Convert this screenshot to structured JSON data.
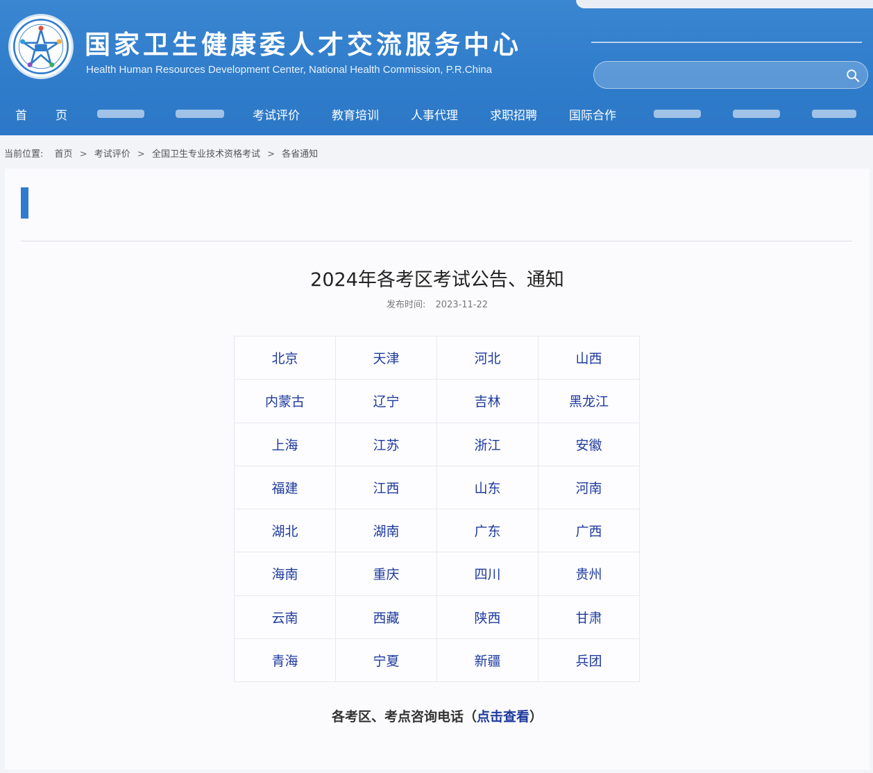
{
  "header": {
    "site_title": "国家卫生健康委人才交流服务中心",
    "site_subtitle": "Health Human Resources Development Center, National Health Commission, P.R.China",
    "search_placeholder": "",
    "colors": {
      "header_blue": "#2f7ccb",
      "link_blue": "#1e3a9e",
      "accent_bar": "#2f7bd0"
    }
  },
  "nav": {
    "items": [
      {
        "label": "首"
      },
      {
        "label": "页"
      },
      {
        "label": "考试评价"
      },
      {
        "label": "教育培训"
      },
      {
        "label": "人事代理"
      },
      {
        "label": "求职招聘"
      },
      {
        "label": "国际合作"
      }
    ]
  },
  "breadcrumb": {
    "prefix": "当前位置:",
    "items": [
      "首页",
      "考试评价",
      "全国卫生专业技术资格考试",
      "各省通知"
    ],
    "separator": ">"
  },
  "article": {
    "title": "2024年各考区考试公告、通知",
    "publish_label": "发布时间:",
    "publish_date": "2023-11-22",
    "regions": [
      [
        "北京",
        "天津",
        "河北",
        "山西"
      ],
      [
        "内蒙古",
        "辽宁",
        "吉林",
        "黑龙江"
      ],
      [
        "上海",
        "江苏",
        "浙江",
        "安徽"
      ],
      [
        "福建",
        "江西",
        "山东",
        "河南"
      ],
      [
        "湖北",
        "湖南",
        "广东",
        "广西"
      ],
      [
        "海南",
        "重庆",
        "四川",
        "贵州"
      ],
      [
        "云南",
        "西藏",
        "陕西",
        "甘肃"
      ],
      [
        "青海",
        "宁夏",
        "新疆",
        "兵团"
      ]
    ],
    "contact_prefix": "各考区、考点咨询电话（",
    "contact_link": "点击查看",
    "contact_suffix": "）"
  }
}
